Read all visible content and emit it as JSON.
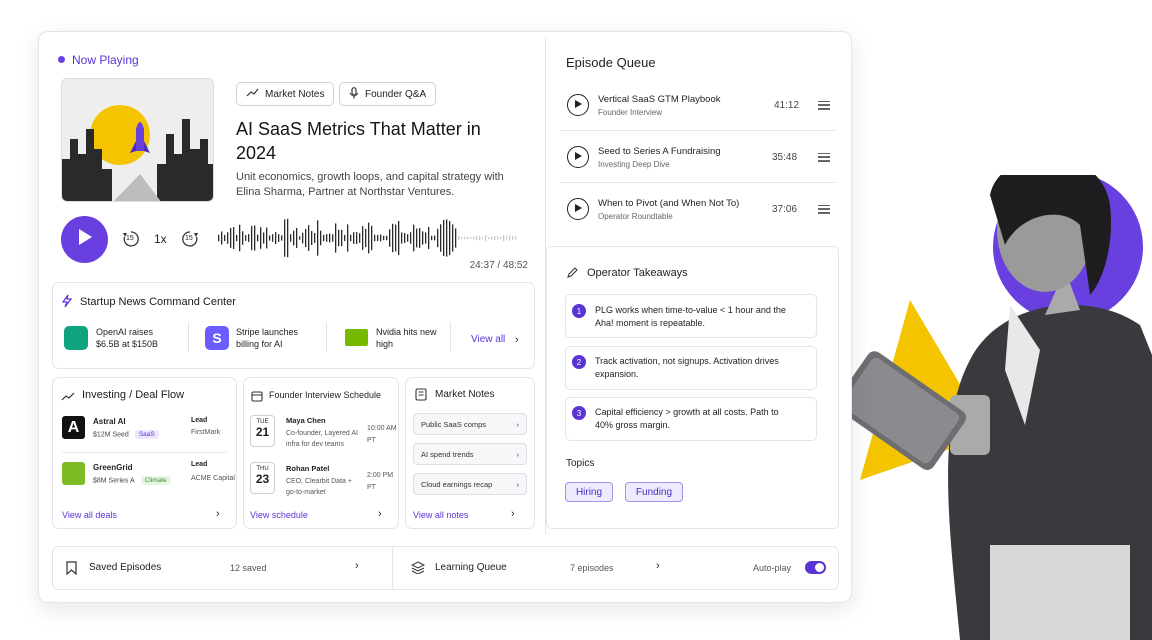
{
  "now_playing": {
    "label": "Now Playing",
    "tags": [
      "Market Notes",
      "Founder Q&A"
    ],
    "title": "AI SaaS Metrics That Matter in 2024",
    "subtitle": "Unit economics, growth loops, and capital strategy with Elina Sharma, Partner at Northstar Ventures.",
    "speed": "1x",
    "skip_back": "15",
    "skip_fwd": "15",
    "time": "24:37 / 48:52"
  },
  "news": {
    "title": "Startup News Command Center",
    "items": [
      {
        "text": "OpenAI raises $6.5B at $150B",
        "icon": "openai-logo"
      },
      {
        "text": "Stripe launches billing for AI",
        "icon": "stripe-logo"
      },
      {
        "text": "Nvidia hits new high",
        "icon": "nvidia-logo"
      }
    ],
    "view_all": "View all"
  },
  "deals": {
    "title": "Investing / Deal Flow",
    "items": [
      {
        "name": "Astral AI",
        "detail": "$12M Seed",
        "tag": "SaaS",
        "role": "Lead",
        "firm": "FirstMark"
      },
      {
        "name": "GreenGrid",
        "detail": "$8M Series A",
        "tag": "Climate",
        "role": "Lead",
        "firm": "ACME Capital"
      }
    ],
    "view_all": "View all deals"
  },
  "schedule": {
    "title": "Founder Interview Schedule",
    "items": [
      {
        "dow": "TUE",
        "day": "21",
        "name": "Maya Chen",
        "desc": "Co-founder, Layered AI infra for dev teams",
        "time": "10:00 AM PT"
      },
      {
        "dow": "THU",
        "day": "23",
        "name": "Rohan Patel",
        "desc": "CEO, Clearbit Data + go-to-market",
        "time": "2:00 PM PT"
      }
    ],
    "view_all": "View schedule"
  },
  "notes": {
    "title": "Market Notes",
    "items": [
      "Public SaaS comps",
      "AI spend trends",
      "Cloud earnings recap"
    ],
    "view_all": "View all notes"
  },
  "queue": {
    "title": "Episode Queue",
    "items": [
      {
        "title": "Vertical SaaS GTM Playbook",
        "show": "Founder Interview",
        "duration": "41:12"
      },
      {
        "title": "Seed to Series A Fundraising",
        "show": "Investing Deep Dive",
        "duration": "35:48"
      },
      {
        "title": "When to Pivot (and When Not To)",
        "show": "Operator Roundtable",
        "duration": "37:06"
      }
    ]
  },
  "takeaways": {
    "title": "Operator Takeaways",
    "items": [
      {
        "num": "1",
        "text": "PLG works when time-to-value < 1 hour and the Aha! moment is repeatable."
      },
      {
        "num": "2",
        "text": "Track activation, not signups. Activation drives expansion."
      },
      {
        "num": "3",
        "text": "Capital efficiency > growth at all costs. Path to 40% gross margin."
      }
    ]
  },
  "topics": {
    "title": "Topics",
    "items": [
      "Hiring",
      "Funding"
    ]
  },
  "footer": {
    "saved_label": "Saved Episodes",
    "saved_count": "12 saved",
    "learning_label": "Learning Queue",
    "learning_count": "7 episodes",
    "autoplay_label": "Auto-play",
    "autoplay_on": true
  },
  "colors": {
    "accent": "#6a3fe0",
    "yellow": "#f5c400"
  }
}
